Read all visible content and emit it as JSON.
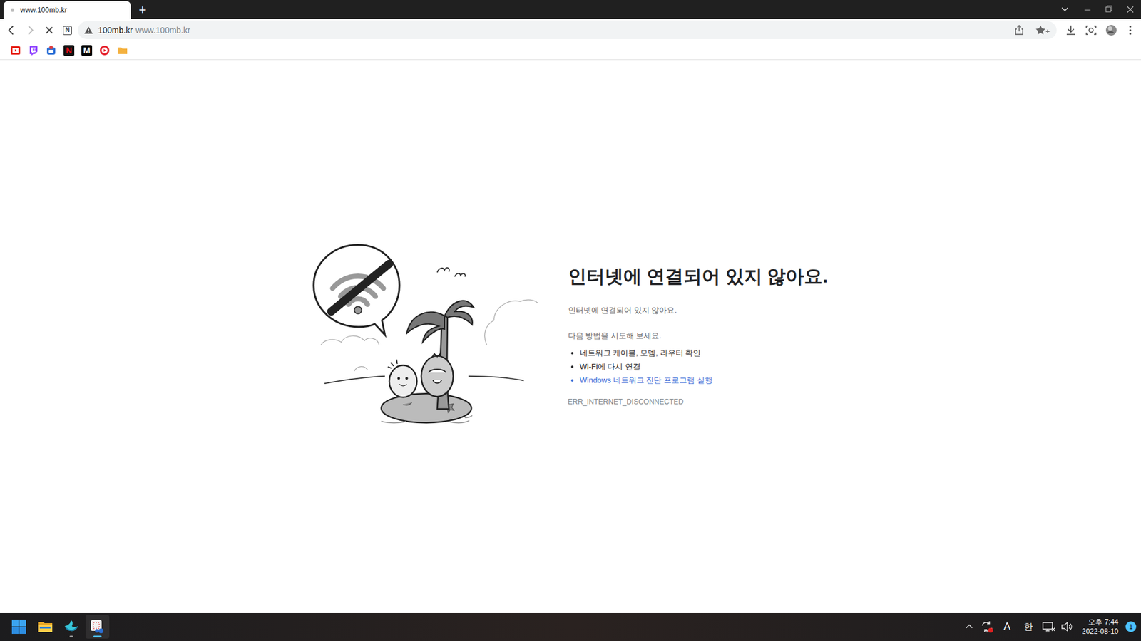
{
  "window": {
    "title": "www.100mb.kr"
  },
  "tab": {
    "title": "www.100mb.kr",
    "loading": true
  },
  "new_tab_button": "+",
  "toolbar": {
    "site_badge": "N"
  },
  "address_bar": {
    "host": "100mb.kr",
    "url": "www.100mb.kr",
    "secure": false
  },
  "bookmarks": [
    {
      "kind": "youtube",
      "glyph": ""
    },
    {
      "kind": "twitch",
      "glyph": ""
    },
    {
      "kind": "app",
      "glyph": ""
    },
    {
      "kind": "netflix",
      "glyph": "N"
    },
    {
      "kind": "medium",
      "glyph": "M"
    },
    {
      "kind": "video",
      "glyph": ""
    },
    {
      "kind": "folder",
      "glyph": ""
    }
  ],
  "error_page": {
    "heading": "인터넷에 연결되어 있지 않아요.",
    "message": "인터넷에 연결되어 있지 않아요.",
    "try_label": "다음 방법을 시도해 보세요.",
    "suggestions": [
      {
        "text": "네트워크 케이블, 모뎀, 라우터 확인",
        "kind": "plain"
      },
      {
        "text": "Wi-Fi에 다시 연결",
        "kind": "plain"
      },
      {
        "text": "Windows 네트워크 진단 프로그램 실행",
        "kind": "link"
      }
    ],
    "error_code": "ERR_INTERNET_DISCONNECTED"
  },
  "taskbar": {
    "apps": [
      {
        "kind": "explorer",
        "running": false,
        "active": false
      },
      {
        "kind": "whale",
        "running": true,
        "active": false
      },
      {
        "kind": "snip",
        "running": true,
        "active": true
      }
    ],
    "tray": {
      "input_mode": "A",
      "ime": "한",
      "time": "오후 7:44",
      "date": "2022-08-10",
      "notifications": "1"
    }
  }
}
